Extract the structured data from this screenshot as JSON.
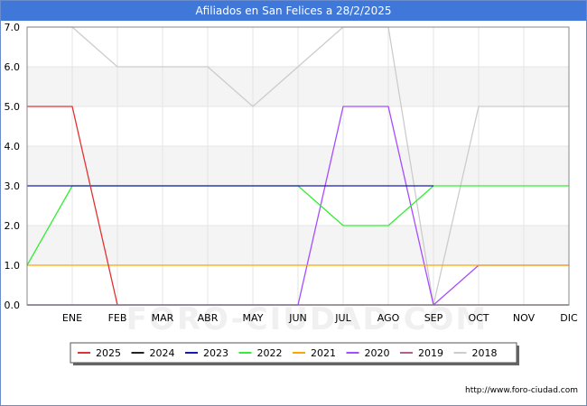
{
  "title": "Afiliados en San Felices a 28/2/2025",
  "footer_url": "http://www.foro-ciudad.com",
  "watermark": "FORO-CIUDAD.COM",
  "chart_data": {
    "type": "line",
    "categories": [
      "",
      "ENE",
      "FEB",
      "MAR",
      "ABR",
      "MAY",
      "JUN",
      "JUL",
      "AGO",
      "SEP",
      "OCT",
      "NOV",
      "DIC"
    ],
    "y_ticks": [
      "0.0",
      "1.0",
      "2.0",
      "3.0",
      "4.0",
      "5.0",
      "6.0",
      "7.0"
    ],
    "ylim": [
      0,
      7
    ],
    "grid": true,
    "legend_position": "bottom",
    "series": [
      {
        "name": "2018",
        "color": "#cccccc",
        "values": [
          7,
          7,
          6,
          6,
          6,
          5,
          6,
          7,
          7,
          0,
          5,
          5,
          5
        ]
      },
      {
        "name": "2019",
        "color": "#b06090",
        "values": [
          0,
          0,
          0,
          0,
          0,
          0,
          0,
          0,
          0,
          0,
          0,
          0,
          0
        ]
      },
      {
        "name": "2020",
        "color": "#a64dff",
        "values": [
          0,
          0,
          0,
          0,
          0,
          0,
          0,
          5,
          5,
          0,
          1,
          1,
          1
        ]
      },
      {
        "name": "2021",
        "color": "#ffa500",
        "values": [
          1,
          1,
          1,
          1,
          1,
          1,
          1,
          1,
          1,
          1,
          1,
          1,
          1
        ]
      },
      {
        "name": "2022",
        "color": "#33ee33",
        "values": [
          1,
          3,
          3,
          3,
          3,
          3,
          3,
          2,
          2,
          3,
          3,
          3,
          3
        ]
      },
      {
        "name": "2023",
        "color": "#1a1ab3",
        "values": [
          3,
          3,
          3,
          3,
          3,
          3,
          3,
          3,
          3,
          3,
          null,
          null,
          null
        ]
      },
      {
        "name": "2024",
        "color": "#222222",
        "values": [
          0,
          0,
          0,
          0,
          0,
          0,
          0,
          0,
          0,
          0,
          0,
          0,
          0
        ]
      },
      {
        "name": "2025",
        "color": "#e03333",
        "values": [
          5,
          5,
          0,
          null,
          null,
          null,
          null,
          null,
          null,
          null,
          null,
          null,
          null
        ]
      }
    ],
    "legend_order": [
      "2025",
      "2024",
      "2023",
      "2022",
      "2021",
      "2020",
      "2019",
      "2018"
    ]
  }
}
